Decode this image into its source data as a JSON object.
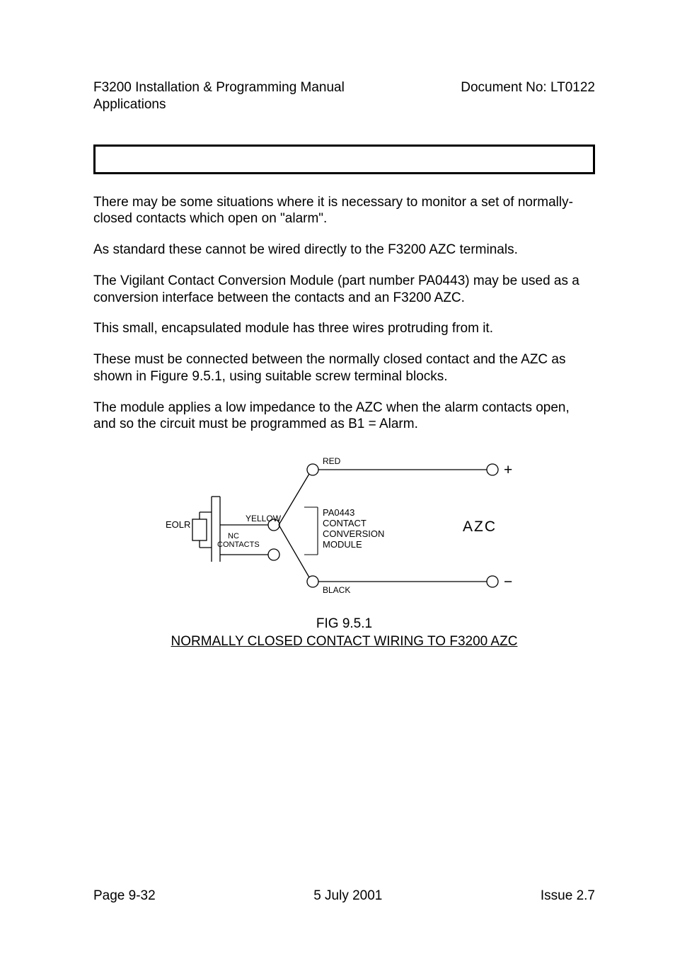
{
  "header": {
    "title_line1": "F3200 Installation & Programming Manual",
    "title_line2": "Applications",
    "doc_no": "Document No: LT0122"
  },
  "body": {
    "p1": "There may be some situations where it is necessary to monitor a set of normally-closed contacts which open on \"alarm\".",
    "p2": "As standard these cannot be wired directly to the F3200 AZC terminals.",
    "p3": "The Vigilant Contact Conversion Module (part number PA0443) may be used as a conversion interface between the contacts and an F3200 AZC.",
    "p4": "This small, encapsulated module has three wires protruding from it.",
    "p5": "These must be connected between the normally closed contact and the AZC as shown in Figure 9.5.1, using suitable screw terminal blocks.",
    "p6": "The module applies a low impedance to the AZC when the alarm contacts open, and so the circuit must be programmed as B1 = Alarm."
  },
  "diagram": {
    "labels": {
      "red": "RED",
      "yellow": "YELLOW",
      "black": "BLACK",
      "eolr": "EOLR",
      "nc1": "NC",
      "nc2": "CONTACTS",
      "azc": "AZC",
      "mod1": "PA0443",
      "mod2": "CONTACT",
      "mod3": "CONVERSION",
      "mod4": "MODULE",
      "plus": "+",
      "minus": "−"
    }
  },
  "caption": {
    "line1": "FIG 9.5.1",
    "line2": "NORMALLY CLOSED CONTACT WIRING TO F3200 AZC"
  },
  "footer": {
    "left": "Page 9-32",
    "center": "5 July 2001",
    "right": "Issue 2.7"
  }
}
